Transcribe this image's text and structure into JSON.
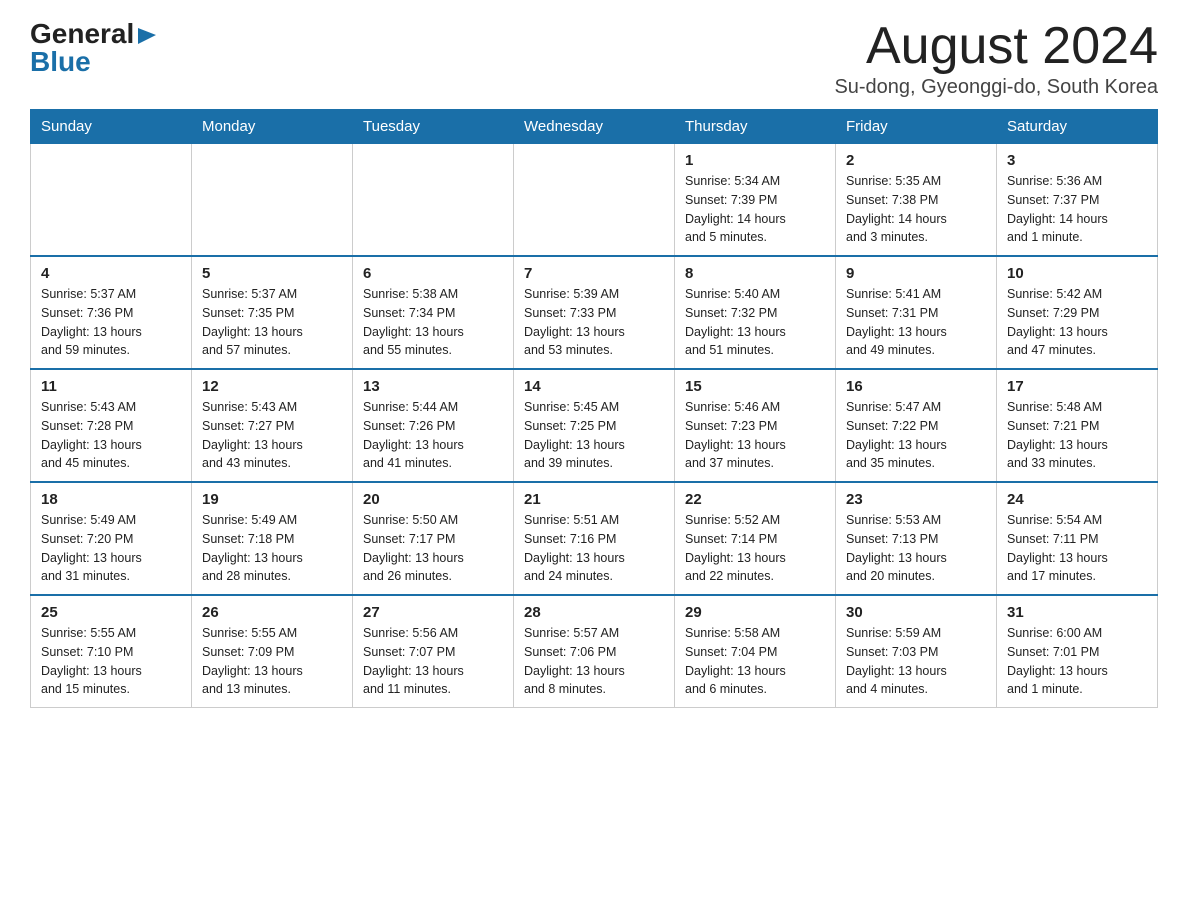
{
  "header": {
    "logo_general": "General",
    "logo_blue": "Blue",
    "month_title": "August 2024",
    "location": "Su-dong, Gyeonggi-do, South Korea"
  },
  "weekdays": [
    "Sunday",
    "Monday",
    "Tuesday",
    "Wednesday",
    "Thursday",
    "Friday",
    "Saturday"
  ],
  "weeks": [
    [
      {
        "day": "",
        "info": ""
      },
      {
        "day": "",
        "info": ""
      },
      {
        "day": "",
        "info": ""
      },
      {
        "day": "",
        "info": ""
      },
      {
        "day": "1",
        "info": "Sunrise: 5:34 AM\nSunset: 7:39 PM\nDaylight: 14 hours\nand 5 minutes."
      },
      {
        "day": "2",
        "info": "Sunrise: 5:35 AM\nSunset: 7:38 PM\nDaylight: 14 hours\nand 3 minutes."
      },
      {
        "day": "3",
        "info": "Sunrise: 5:36 AM\nSunset: 7:37 PM\nDaylight: 14 hours\nand 1 minute."
      }
    ],
    [
      {
        "day": "4",
        "info": "Sunrise: 5:37 AM\nSunset: 7:36 PM\nDaylight: 13 hours\nand 59 minutes."
      },
      {
        "day": "5",
        "info": "Sunrise: 5:37 AM\nSunset: 7:35 PM\nDaylight: 13 hours\nand 57 minutes."
      },
      {
        "day": "6",
        "info": "Sunrise: 5:38 AM\nSunset: 7:34 PM\nDaylight: 13 hours\nand 55 minutes."
      },
      {
        "day": "7",
        "info": "Sunrise: 5:39 AM\nSunset: 7:33 PM\nDaylight: 13 hours\nand 53 minutes."
      },
      {
        "day": "8",
        "info": "Sunrise: 5:40 AM\nSunset: 7:32 PM\nDaylight: 13 hours\nand 51 minutes."
      },
      {
        "day": "9",
        "info": "Sunrise: 5:41 AM\nSunset: 7:31 PM\nDaylight: 13 hours\nand 49 minutes."
      },
      {
        "day": "10",
        "info": "Sunrise: 5:42 AM\nSunset: 7:29 PM\nDaylight: 13 hours\nand 47 minutes."
      }
    ],
    [
      {
        "day": "11",
        "info": "Sunrise: 5:43 AM\nSunset: 7:28 PM\nDaylight: 13 hours\nand 45 minutes."
      },
      {
        "day": "12",
        "info": "Sunrise: 5:43 AM\nSunset: 7:27 PM\nDaylight: 13 hours\nand 43 minutes."
      },
      {
        "day": "13",
        "info": "Sunrise: 5:44 AM\nSunset: 7:26 PM\nDaylight: 13 hours\nand 41 minutes."
      },
      {
        "day": "14",
        "info": "Sunrise: 5:45 AM\nSunset: 7:25 PM\nDaylight: 13 hours\nand 39 minutes."
      },
      {
        "day": "15",
        "info": "Sunrise: 5:46 AM\nSunset: 7:23 PM\nDaylight: 13 hours\nand 37 minutes."
      },
      {
        "day": "16",
        "info": "Sunrise: 5:47 AM\nSunset: 7:22 PM\nDaylight: 13 hours\nand 35 minutes."
      },
      {
        "day": "17",
        "info": "Sunrise: 5:48 AM\nSunset: 7:21 PM\nDaylight: 13 hours\nand 33 minutes."
      }
    ],
    [
      {
        "day": "18",
        "info": "Sunrise: 5:49 AM\nSunset: 7:20 PM\nDaylight: 13 hours\nand 31 minutes."
      },
      {
        "day": "19",
        "info": "Sunrise: 5:49 AM\nSunset: 7:18 PM\nDaylight: 13 hours\nand 28 minutes."
      },
      {
        "day": "20",
        "info": "Sunrise: 5:50 AM\nSunset: 7:17 PM\nDaylight: 13 hours\nand 26 minutes."
      },
      {
        "day": "21",
        "info": "Sunrise: 5:51 AM\nSunset: 7:16 PM\nDaylight: 13 hours\nand 24 minutes."
      },
      {
        "day": "22",
        "info": "Sunrise: 5:52 AM\nSunset: 7:14 PM\nDaylight: 13 hours\nand 22 minutes."
      },
      {
        "day": "23",
        "info": "Sunrise: 5:53 AM\nSunset: 7:13 PM\nDaylight: 13 hours\nand 20 minutes."
      },
      {
        "day": "24",
        "info": "Sunrise: 5:54 AM\nSunset: 7:11 PM\nDaylight: 13 hours\nand 17 minutes."
      }
    ],
    [
      {
        "day": "25",
        "info": "Sunrise: 5:55 AM\nSunset: 7:10 PM\nDaylight: 13 hours\nand 15 minutes."
      },
      {
        "day": "26",
        "info": "Sunrise: 5:55 AM\nSunset: 7:09 PM\nDaylight: 13 hours\nand 13 minutes."
      },
      {
        "day": "27",
        "info": "Sunrise: 5:56 AM\nSunset: 7:07 PM\nDaylight: 13 hours\nand 11 minutes."
      },
      {
        "day": "28",
        "info": "Sunrise: 5:57 AM\nSunset: 7:06 PM\nDaylight: 13 hours\nand 8 minutes."
      },
      {
        "day": "29",
        "info": "Sunrise: 5:58 AM\nSunset: 7:04 PM\nDaylight: 13 hours\nand 6 minutes."
      },
      {
        "day": "30",
        "info": "Sunrise: 5:59 AM\nSunset: 7:03 PM\nDaylight: 13 hours\nand 4 minutes."
      },
      {
        "day": "31",
        "info": "Sunrise: 6:00 AM\nSunset: 7:01 PM\nDaylight: 13 hours\nand 1 minute."
      }
    ]
  ]
}
